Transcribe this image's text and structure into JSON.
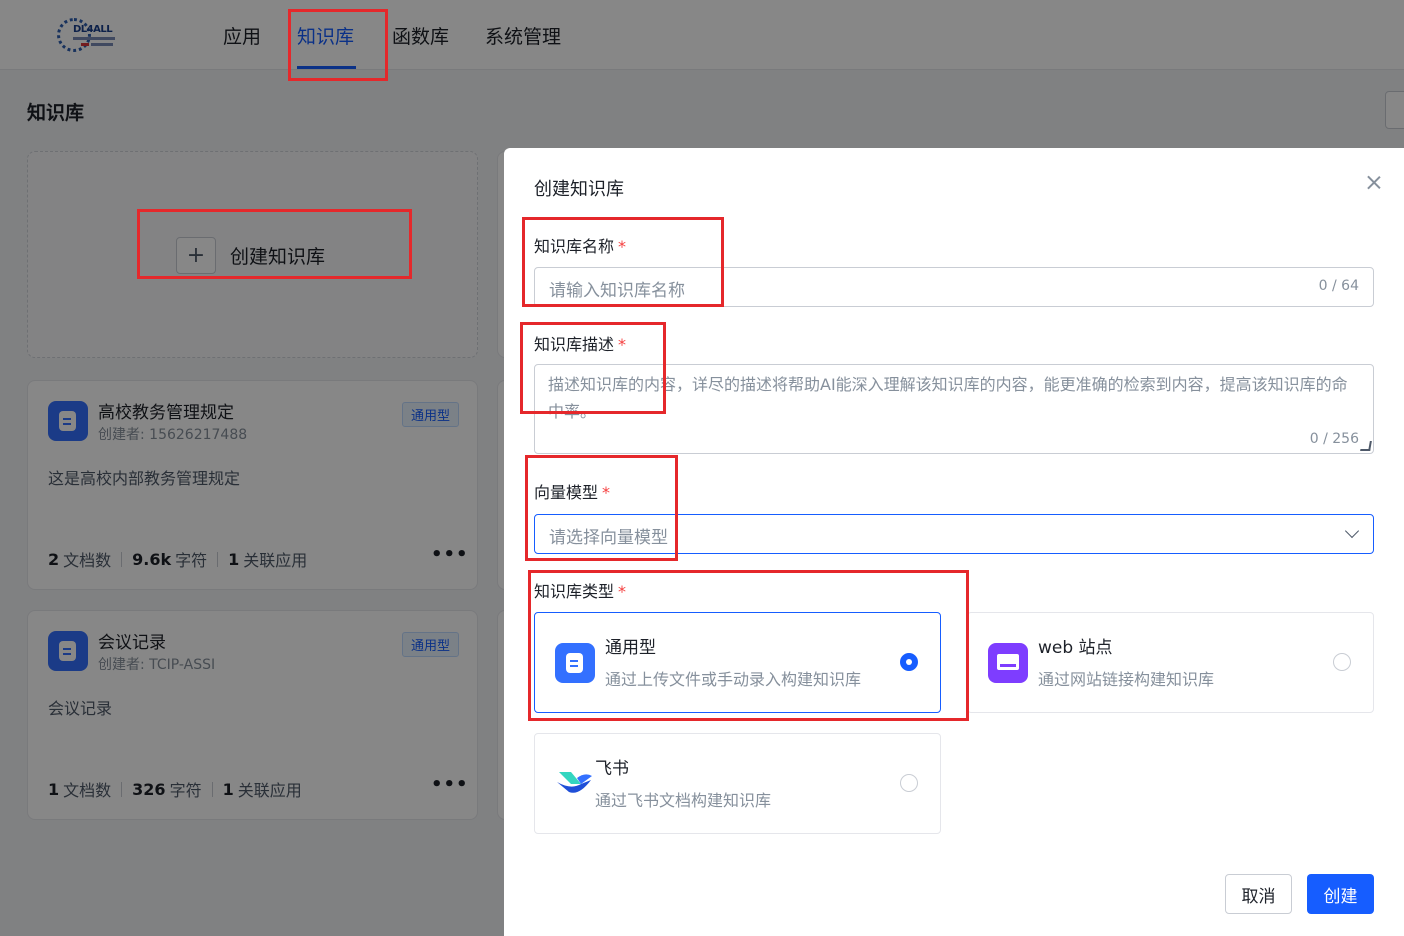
{
  "nav": {
    "logo_text": "DL4ALL",
    "items": [
      "应用",
      "知识库",
      "函数库",
      "系统管理"
    ],
    "active": "知识库"
  },
  "page": {
    "title": "知识库",
    "create_label": "创建知识库"
  },
  "cards": [
    {
      "name": "高校教务管理规定",
      "creator": "创建者: 15626217488",
      "tag": "通用型",
      "desc": "这是高校内部教务管理规定",
      "docs": "2",
      "docs_label": "文档数",
      "chars": "9.6k",
      "chars_label": "字符",
      "apps": "1",
      "apps_label": "关联应用",
      "more": "•••"
    },
    {
      "name": "会议记录",
      "creator": "创建者: TCIP-ASSI",
      "tag": "通用型",
      "desc": "会议记录",
      "docs": "1",
      "docs_label": "文档数",
      "chars": "326",
      "chars_label": "字符",
      "apps": "1",
      "apps_label": "关联应用",
      "more": "•••"
    }
  ],
  "drawer": {
    "title": "创建知识库",
    "name_field": {
      "label": "知识库名称",
      "placeholder": "请输入知识库名称",
      "counter": "0 / 64"
    },
    "desc_field": {
      "label": "知识库描述",
      "placeholder": "描述知识库的内容，详尽的描述将帮助AI能深入理解该知识库的内容，能更准确的检索到内容，提高该知识库的命中率。",
      "counter": "0 / 256"
    },
    "model_field": {
      "label": "向量模型",
      "placeholder": "请选择向量模型"
    },
    "type_field": {
      "label": "知识库类型",
      "options": [
        {
          "title": "通用型",
          "desc": "通过上传文件或手动录入构建知识库",
          "selected": true,
          "icon": "document-icon"
        },
        {
          "title": "web 站点",
          "desc": "通过网站链接构建知识库",
          "selected": false,
          "icon": "web-icon"
        },
        {
          "title": "飞书",
          "desc": "通过飞书文档构建知识库",
          "selected": false,
          "icon": "feishu-icon"
        }
      ]
    },
    "required_mark": "*",
    "cancel_label": "取消",
    "create_label": "创建"
  },
  "colors": {
    "primary": "#165dff",
    "annotation": "#e5282b",
    "required": "#f53f3f",
    "web_icon": "#7e3dff"
  }
}
